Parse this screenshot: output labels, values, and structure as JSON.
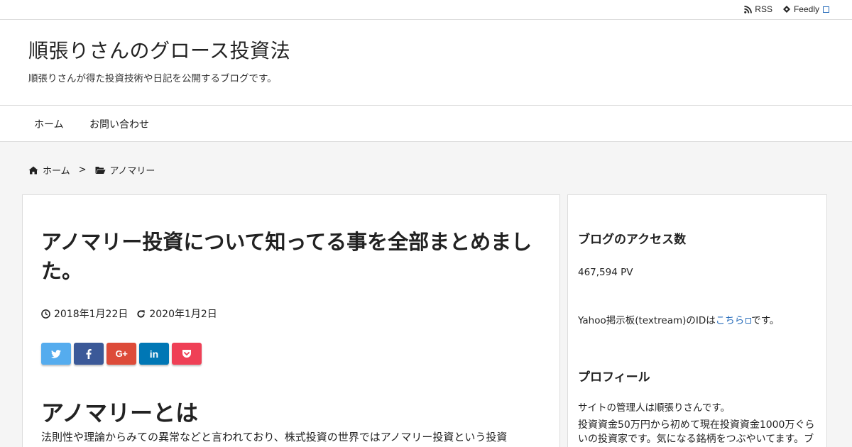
{
  "topbar": {
    "rss_label": "RSS",
    "feedly_label": "Feedly"
  },
  "header": {
    "site_title": "順張りさんのグロース投資法",
    "site_description": "順張りさんが得た投資技術や日記を公開するブログです。"
  },
  "nav": {
    "items": [
      {
        "label": "ホーム"
      },
      {
        "label": "お問い合わせ"
      }
    ]
  },
  "breadcrumb": {
    "home": "ホーム",
    "separator": ">",
    "category": "アノマリー"
  },
  "post": {
    "title": "アノマリー投資について知ってる事を全部まとめました。",
    "published": "2018年1月22日",
    "updated": "2020年1月2日",
    "share_buttons": [
      {
        "icon": "twitter-icon",
        "label": "🐦",
        "color": "#55acee"
      },
      {
        "icon": "facebook-icon",
        "label": "f",
        "color": "#3b5998"
      },
      {
        "icon": "google-plus-icon",
        "label": "G+",
        "color": "#dd4b39"
      },
      {
        "icon": "linkedin-icon",
        "label": "in",
        "color": "#0077b5"
      },
      {
        "icon": "pocket-icon",
        "label": "⌄",
        "color": "#ef4056"
      }
    ],
    "heading": "アノマリーとは",
    "body": "法則性や理論からみての異常などと言われており、株式投資の世界ではアノマリー投資という投資"
  },
  "sidebar": {
    "access_title": "ブログのアクセス数",
    "access_count": "467,594 PV",
    "yahoo_prefix": "Yahoo掲示板(textream)のIDは",
    "yahoo_link": "こちら",
    "yahoo_suffix": "です。",
    "profile_title": "プロフィール",
    "profile_line1": "サイトの管理人は順張りさんです。",
    "profile_para": "投資資金50万円から初めて現在投資資金1000万ぐらいの投資家です。気になる銘柄をつぶやいてます。ブ"
  }
}
